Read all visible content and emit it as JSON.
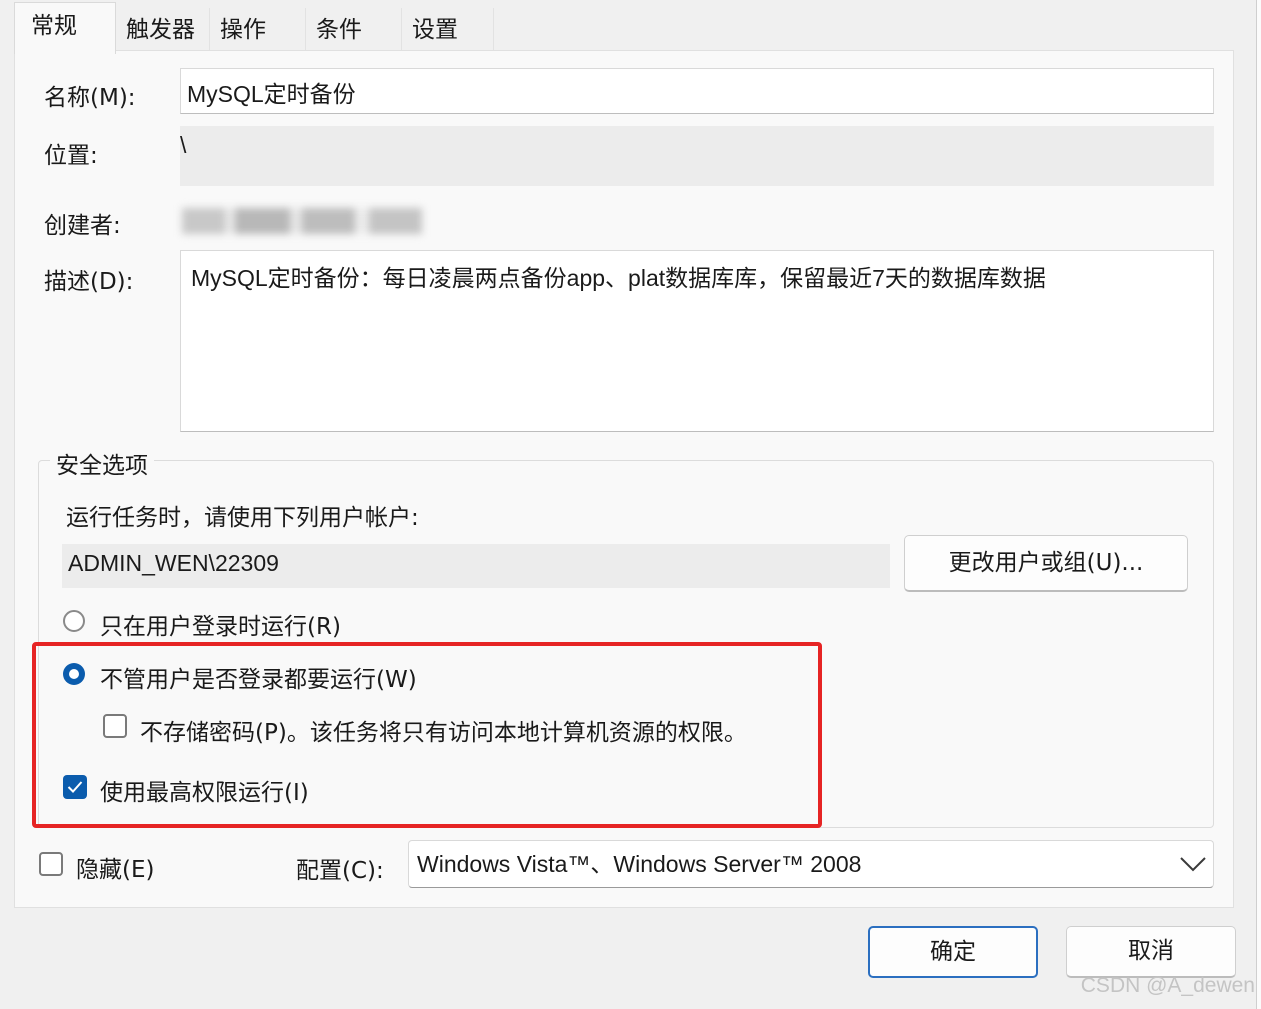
{
  "tabs": [
    {
      "label": "常规",
      "active": true
    },
    {
      "label": "触发器",
      "active": false
    },
    {
      "label": "操作",
      "active": false
    },
    {
      "label": "条件",
      "active": false
    },
    {
      "label": "设置",
      "active": false
    }
  ],
  "general": {
    "name_label": "名称(M):",
    "name_value": "MySQL定时备份",
    "location_label": "位置:",
    "location_value": "\\",
    "author_label": "创建者:",
    "description_label": "描述(D):",
    "description_value": "MySQL定时备份：每日凌晨两点备份app、plat数据库库，保留最近7天的数据库数据"
  },
  "security": {
    "legend": "安全选项",
    "run_as_prompt": "运行任务时，请使用下列用户帐户:",
    "user_account": "ADMIN_WEN\\22309",
    "change_user_button": "更改用户或组(U)...",
    "option_logged_on": "只在用户登录时运行(R)",
    "option_logged_on_checked": false,
    "option_whether_logged": "不管用户是否登录都要运行(W)",
    "option_whether_logged_checked": true,
    "no_store_password": "不存储密码(P)。该任务将只有访问本地计算机资源的权限。",
    "no_store_password_checked": false,
    "highest_privileges": "使用最高权限运行(I)",
    "highest_privileges_checked": true
  },
  "bottom": {
    "hidden_label": "隐藏(E)",
    "hidden_checked": false,
    "configure_label": "配置(C):",
    "configure_value": "Windows Vista™、Windows Server™ 2008"
  },
  "buttons": {
    "ok": "确定",
    "cancel": "取消"
  },
  "watermark": "CSDN @A_dewen",
  "colors": {
    "accent": "#0b5cad",
    "highlight_box": "#e62424",
    "panel_bg": "#f9f9f9",
    "window_bg": "#f0f0f0"
  }
}
